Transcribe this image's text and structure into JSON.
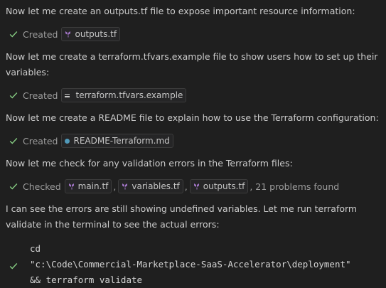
{
  "messages": [
    "Now let me create an outputs.tf file to expose important resource information:",
    "Now let me create a terraform.tfvars.example file to show users how to set up their variables:",
    "Now let me create a README file to explain how to use the Terraform configuration:",
    "Now let me check for any validation errors in the Terraform files:",
    "I can see the errors are still showing undefined variables. Let me run terraform validate in the terminal to see the actual errors:"
  ],
  "actions": [
    {
      "verb": "Created",
      "files": [
        {
          "name": "outputs.tf",
          "icon": "terraform-icon"
        }
      ]
    },
    {
      "verb": "Created",
      "files": [
        {
          "name": "terraform.tfvars.example",
          "icon": "tfvars-icon"
        }
      ]
    },
    {
      "verb": "Created",
      "files": [
        {
          "name": "README-Terraform.md",
          "icon": "markdown-icon"
        }
      ]
    },
    {
      "verb": "Checked",
      "files": [
        {
          "name": "main.tf",
          "icon": "terraform-icon"
        },
        {
          "name": "variables.tf",
          "icon": "terraform-icon"
        },
        {
          "name": "outputs.tf",
          "icon": "terraform-icon"
        }
      ],
      "tail": ", 21 problems found"
    }
  ],
  "terminal": {
    "lines": [
      "cd",
      "\"c:\\Code\\Commercial-Marketplace-SaaS-Accelerator\\deployment\"",
      "&& terraform validate"
    ]
  },
  "colors": {
    "background": "#1f1f1f",
    "text": "#cccccc",
    "muted": "#9d9d9d",
    "check": "#89d185",
    "terraform": "#a074c4",
    "markdown": "#519aba"
  }
}
